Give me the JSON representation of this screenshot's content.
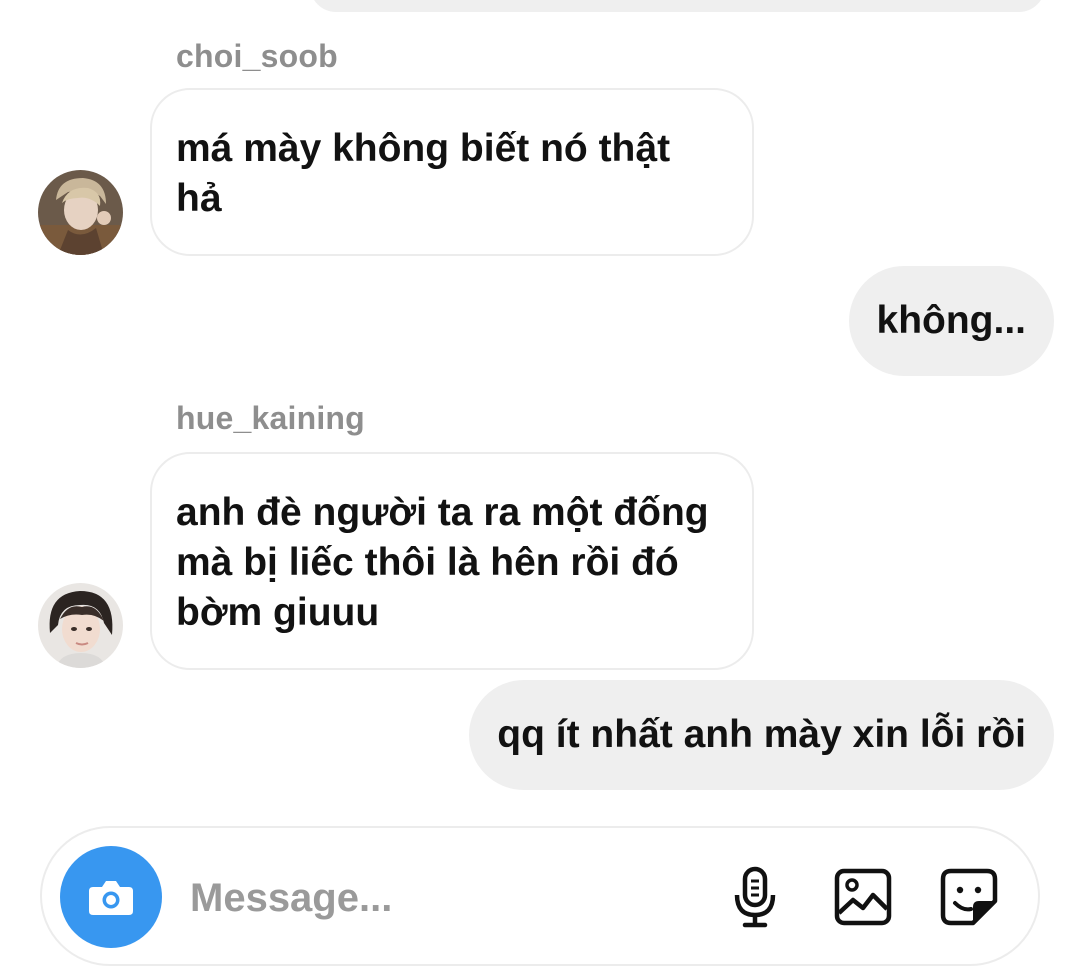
{
  "thread": {
    "messages": [
      {
        "sender": "choi_soob",
        "direction": "in",
        "text": "má mày không biết nó thật hả"
      },
      {
        "sender": "me",
        "direction": "out",
        "text": "không..."
      },
      {
        "sender": "hue_kaining",
        "direction": "in",
        "text": "anh đè người ta ra một đống mà bị liếc thôi là hên rồi đó bờm giuuu"
      },
      {
        "sender": "me",
        "direction": "out",
        "text": "qq ít nhất anh mày xin lỗi rồi"
      }
    ]
  },
  "composer": {
    "placeholder": "Message...",
    "value": "",
    "icons": {
      "camera": "camera-icon",
      "microphone": "microphone-icon",
      "gallery": "gallery-icon",
      "sticker": "sticker-icon"
    }
  },
  "colors": {
    "accent": "#3897f0",
    "outgoing_bubble": "#efefef",
    "incoming_border": "#ececec",
    "username": "#8e8e8e",
    "placeholder": "#9a9a9a"
  }
}
